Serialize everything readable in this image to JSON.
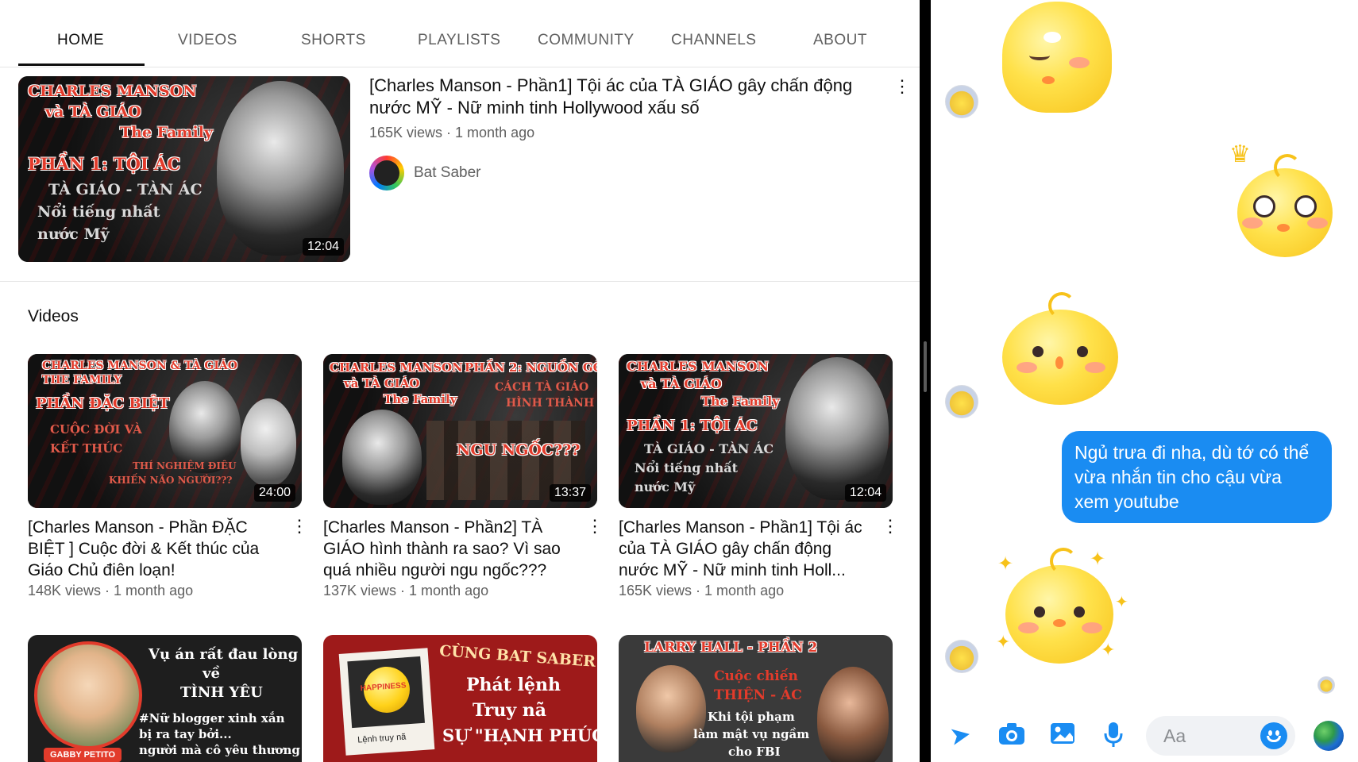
{
  "youtube": {
    "tabs": [
      "HOME",
      "VIDEOS",
      "SHORTS",
      "PLAYLISTS",
      "COMMUNITY",
      "CHANNELS",
      "ABOUT"
    ],
    "active_tab": "HOME",
    "featured": {
      "title": "[Charles Manson - Phần1] Tội ác của TÀ GIÁO gây chấn động nước MỸ -  Nữ minh tinh Hollywood xấu số",
      "meta": "165K views · 1 month ago",
      "channel": "Bat Saber",
      "duration": "12:04",
      "thumb_text": [
        "CHARLES MANSON",
        "và TÀ GIÁO",
        "The Family",
        "PHẦN 1: TỘI ÁC",
        "TÀ GIÁO - TÀN ÁC",
        "Nổi tiếng nhất",
        "nước Mỹ"
      ]
    },
    "section_title": "Videos",
    "videos": [
      {
        "title": "[Charles Manson - Phần ĐẶC BIỆT ] Cuộc đời & Kết thúc của Giáo Chủ điên loạn!",
        "meta": "148K views · 1 month ago",
        "duration": "24:00",
        "thumb_text": [
          "CHARLES MANSON & TÀ GIÁO",
          "THE FAMILY",
          "PHẦN ĐẶC BIỆT",
          "CUỘC ĐỜI VÀ",
          "KẾT THÚC",
          "THÍ NGHIỆM ĐIÊU",
          "KHIẾN NÃO NGƯỜI???"
        ]
      },
      {
        "title": "[Charles Manson - Phần2] TÀ GIÁO hình thành ra sao? Vì sao quá nhiều người ngu ngốc???",
        "meta": "137K views · 1 month ago",
        "duration": "13:37",
        "thumb_text": [
          "CHARLES MANSON",
          "và TÀ GIÁO",
          "The Family",
          "PHẦN 2: NGUỒN GỐC",
          "CÁCH TÀ GIÁO",
          "HÌNH THÀNH",
          "NGU NGỐC???"
        ]
      },
      {
        "title": "[Charles Manson - Phần1] Tội ác của TÀ GIÁO gây chấn động nước MỸ -  Nữ minh tinh Holl...",
        "meta": "165K views · 1 month ago",
        "duration": "12:04",
        "thumb_text": [
          "CHARLES MANSON",
          "và TÀ GIÁO",
          "The Family",
          "PHẦN 1: TỘI ÁC",
          "TÀ GIÁO - TÀN ÁC",
          "Nổi tiếng nhất",
          "nước Mỹ"
        ]
      }
    ],
    "row2_thumbs": [
      {
        "lines": [
          "Vụ án rất đau lòng",
          "về",
          "TÌNH YÊU",
          "#Nữ blogger xinh xắn",
          "bị ra tay bởi...",
          "người mà cô yêu thương"
        ],
        "tag": "GABBY PETITO"
      },
      {
        "lines": [
          "CÙNG BAT SABER",
          "Phát lệnh",
          "Truy nã",
          "SỰ \"HẠNH PHÚC\""
        ],
        "polaroid": "Lệnh truy nã",
        "ball": "HAPPINESS"
      },
      {
        "lines": [
          "LARRY HALL - PHẦN 2",
          "Cuộc chiến",
          "THIỆN - ÁC",
          "Khi tội phạm",
          "làm mật vụ ngầm",
          "cho FBI"
        ]
      }
    ]
  },
  "messenger": {
    "outgoing_message": "Ngủ trưa đi nha, dù tớ có thể vừa nhắn tin cho cậu vừa xem youtube",
    "input_placeholder": "Aa",
    "icons": [
      "send-icon",
      "camera-icon",
      "photo-icon",
      "microphone-icon",
      "emoji-icon",
      "globe-icon"
    ],
    "accent": "#1a8cf2"
  }
}
